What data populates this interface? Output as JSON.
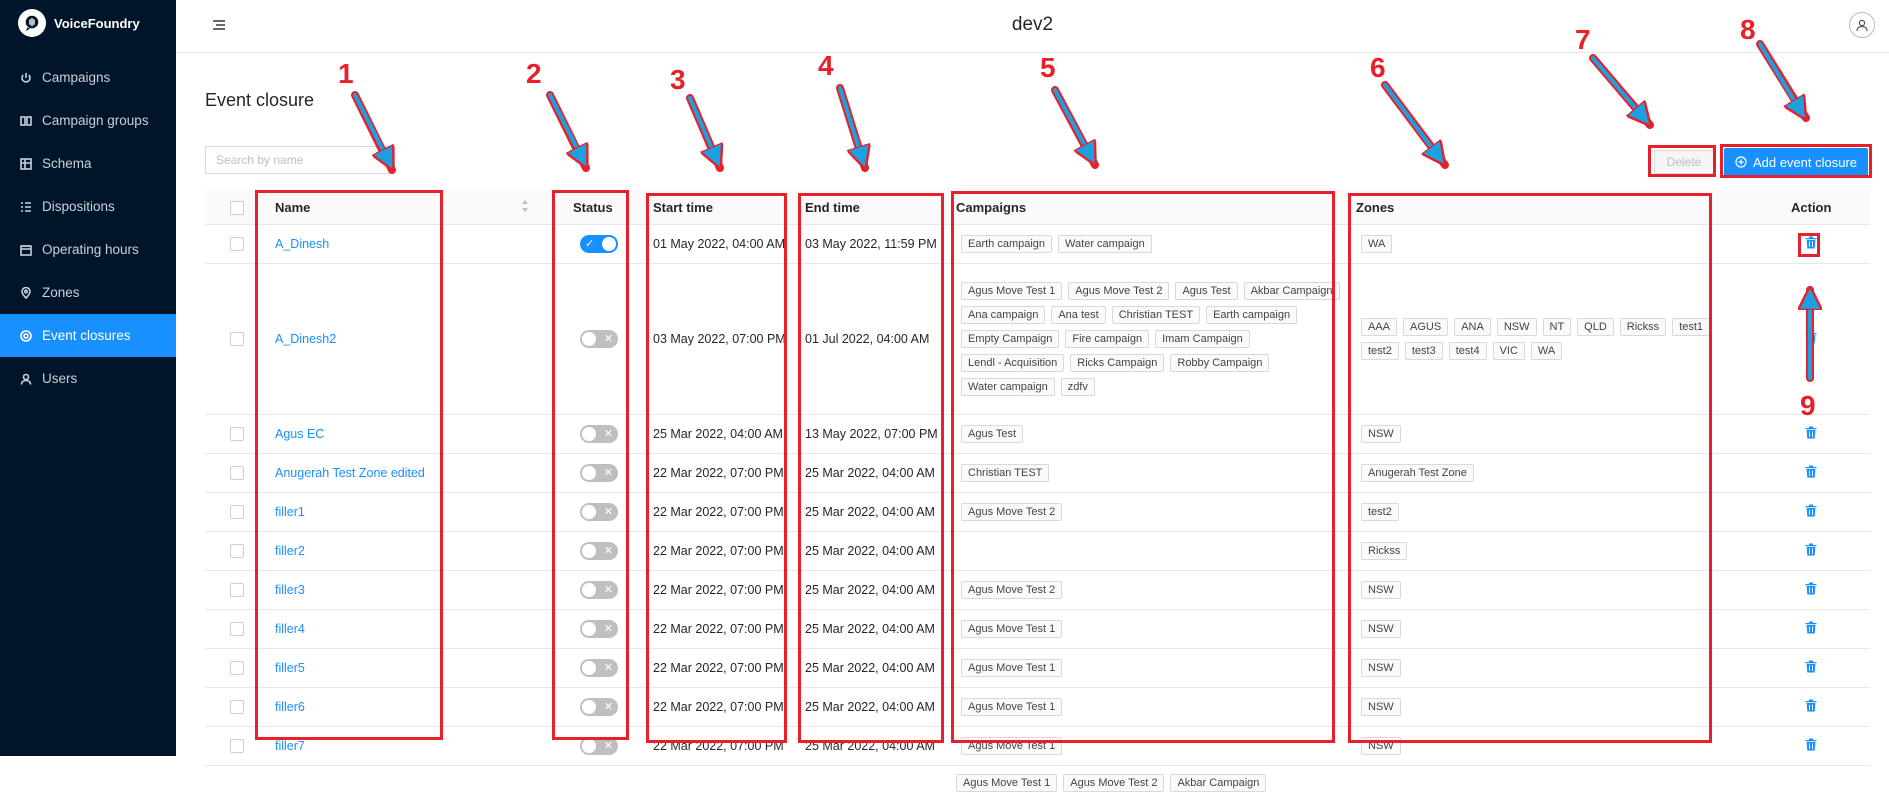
{
  "brand": {
    "name": "VoiceFoundry"
  },
  "sidebar": {
    "items": [
      {
        "label": "Campaigns",
        "icon": "power-icon"
      },
      {
        "label": "Campaign groups",
        "icon": "groups-icon"
      },
      {
        "label": "Schema",
        "icon": "table-icon"
      },
      {
        "label": "Dispositions",
        "icon": "list-icon"
      },
      {
        "label": "Operating hours",
        "icon": "calendar-icon"
      },
      {
        "label": "Zones",
        "icon": "location-icon"
      },
      {
        "label": "Event closures",
        "icon": "target-icon",
        "active": true
      },
      {
        "label": "Users",
        "icon": "user-icon"
      }
    ]
  },
  "header": {
    "title": "dev2"
  },
  "page": {
    "title": "Event closure",
    "search_placeholder": "Search by name",
    "delete_label": "Delete",
    "add_label": "Add event closure"
  },
  "table": {
    "columns": {
      "name": "Name",
      "status": "Status",
      "start": "Start time",
      "end": "End time",
      "campaigns": "Campaigns",
      "zones": "Zones",
      "action": "Action"
    },
    "rows": [
      {
        "name": "A_Dinesh",
        "status": true,
        "start": "01 May 2022, 04:00 AM",
        "end": "03 May 2022, 11:59 PM",
        "campaigns": [
          "Earth campaign",
          "Water campaign"
        ],
        "zones": [
          "WA"
        ]
      },
      {
        "name": "A_Dinesh2",
        "status": false,
        "start": "03 May 2022, 07:00 PM",
        "end": "01 Jul 2022, 04:00 AM",
        "campaigns": [
          "Agus Move Test 1",
          "Agus Move Test 2",
          "Agus Test",
          "Akbar Campaign",
          "Ana campaign",
          "Ana test",
          "Christian TEST",
          "Earth campaign",
          "Empty Campaign",
          "Fire campaign",
          "Imam Campaign",
          "Lendl - Acquisition",
          "Ricks Campaign",
          "Robby Campaign",
          "Water campaign",
          "zdfv"
        ],
        "zones": [
          "AAA",
          "AGUS",
          "ANA",
          "NSW",
          "NT",
          "QLD",
          "Rickss",
          "test1",
          "test2",
          "test3",
          "test4",
          "VIC",
          "WA"
        ]
      },
      {
        "name": "Agus EC",
        "status": false,
        "start": "25 Mar 2022, 04:00 AM",
        "end": "13 May 2022, 07:00 PM",
        "campaigns": [
          "Agus Test"
        ],
        "zones": [
          "NSW"
        ]
      },
      {
        "name": "Anugerah Test Zone edited",
        "status": false,
        "start": "22 Mar 2022, 07:00 PM",
        "end": "25 Mar 2022, 04:00 AM",
        "campaigns": [
          "Christian TEST"
        ],
        "zones": [
          "Anugerah Test Zone"
        ]
      },
      {
        "name": "filler1",
        "status": false,
        "start": "22 Mar 2022, 07:00 PM",
        "end": "25 Mar 2022, 04:00 AM",
        "campaigns": [
          "Agus Move Test 2"
        ],
        "zones": [
          "test2"
        ]
      },
      {
        "name": "filler2",
        "status": false,
        "start": "22 Mar 2022, 07:00 PM",
        "end": "25 Mar 2022, 04:00 AM",
        "campaigns": [],
        "zones": [
          "Rickss"
        ]
      },
      {
        "name": "filler3",
        "status": false,
        "start": "22 Mar 2022, 07:00 PM",
        "end": "25 Mar 2022, 04:00 AM",
        "campaigns": [
          "Agus Move Test 2"
        ],
        "zones": [
          "NSW"
        ]
      },
      {
        "name": "filler4",
        "status": false,
        "start": "22 Mar 2022, 07:00 PM",
        "end": "25 Mar 2022, 04:00 AM",
        "campaigns": [
          "Agus Move Test 1"
        ],
        "zones": [
          "NSW"
        ]
      },
      {
        "name": "filler5",
        "status": false,
        "start": "22 Mar 2022, 07:00 PM",
        "end": "25 Mar 2022, 04:00 AM",
        "campaigns": [
          "Agus Move Test 1"
        ],
        "zones": [
          "NSW"
        ]
      },
      {
        "name": "filler6",
        "status": false,
        "start": "22 Mar 2022, 07:00 PM",
        "end": "25 Mar 2022, 04:00 AM",
        "campaigns": [
          "Agus Move Test 1"
        ],
        "zones": [
          "NSW"
        ]
      },
      {
        "name": "filler7",
        "status": false,
        "start": "22 Mar 2022, 07:00 PM",
        "end": "25 Mar 2022, 04:00 AM",
        "campaigns": [
          "Agus Move Test 1"
        ],
        "zones": [
          "NSW"
        ]
      }
    ],
    "partial_row_campaigns": [
      "Agus Move Test 1",
      "Agus Move Test 2",
      "Akbar Campaign"
    ]
  },
  "annotations": [
    "1",
    "2",
    "3",
    "4",
    "5",
    "6",
    "7",
    "8",
    "9"
  ],
  "colors": {
    "sidebar_bg": "#001529",
    "accent": "#1890ff",
    "annotation": "#e8202a"
  }
}
